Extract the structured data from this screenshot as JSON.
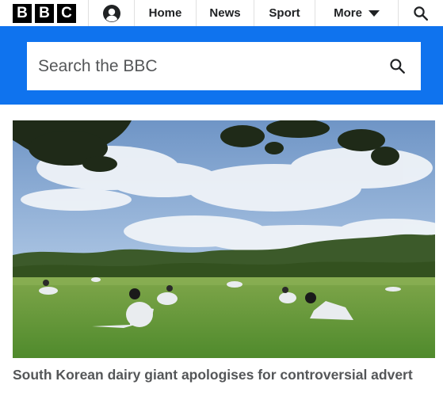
{
  "brand": {
    "letters": [
      "B",
      "B",
      "C"
    ]
  },
  "nav": {
    "home": "Home",
    "news": "News",
    "sport": "Sport",
    "more": "More"
  },
  "search": {
    "placeholder": "Search the BBC"
  },
  "story": {
    "headline": "South Korean dairy giant apologises for controversial advert"
  },
  "colors": {
    "brand_blue": "#0f73ee",
    "logo_black": "#000000",
    "headline_gray": "#545658"
  },
  "icons": [
    "user-account-icon",
    "chevron-down-icon",
    "search-icon"
  ]
}
